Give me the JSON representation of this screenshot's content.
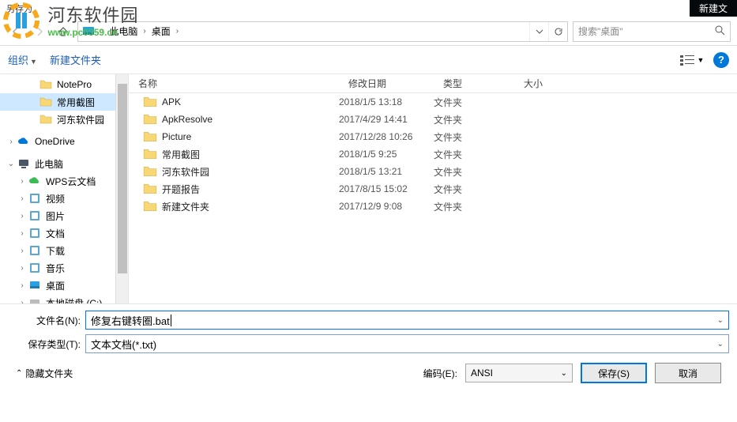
{
  "topbar": {
    "saveas": "另存为",
    "newtab": "新建文"
  },
  "watermark": {
    "title": "河东软件园",
    "url": "www.pc0359.cn"
  },
  "breadcrumb": {
    "root": "此电脑",
    "current": "桌面"
  },
  "search": {
    "placeholder": "搜索\"桌面\""
  },
  "toolbar": {
    "organize": "组织",
    "newfolder": "新建文件夹"
  },
  "sidebar": {
    "items": [
      {
        "label": "NotePro",
        "type": "folder"
      },
      {
        "label": "常用截图",
        "type": "folder",
        "selected": true
      },
      {
        "label": "河东软件园",
        "type": "folder"
      },
      {
        "label": "OneDrive",
        "type": "cloud",
        "exp": ">"
      },
      {
        "label": "此电脑",
        "type": "pc",
        "exp": "⌄"
      },
      {
        "label": "WPS云文档",
        "type": "cloud2",
        "exp": ">"
      },
      {
        "label": "视频",
        "type": "lib",
        "exp": ">"
      },
      {
        "label": "图片",
        "type": "lib",
        "exp": ">"
      },
      {
        "label": "文档",
        "type": "lib",
        "exp": ">"
      },
      {
        "label": "下载",
        "type": "lib",
        "exp": ">"
      },
      {
        "label": "音乐",
        "type": "lib",
        "exp": ">"
      },
      {
        "label": "桌面",
        "type": "desktop",
        "exp": ">",
        "active": true
      },
      {
        "label": "本地磁盘 (C:)",
        "type": "disk",
        "exp": ">"
      }
    ]
  },
  "columns": {
    "name": "名称",
    "date": "修改日期",
    "type": "类型",
    "size": "大小"
  },
  "files": [
    {
      "name": "APK",
      "date": "2018/1/5 13:18",
      "type": "文件夹"
    },
    {
      "name": "ApkResolve",
      "date": "2017/4/29 14:41",
      "type": "文件夹"
    },
    {
      "name": "Picture",
      "date": "2017/12/28 10:26",
      "type": "文件夹"
    },
    {
      "name": "常用截图",
      "date": "2018/1/5 9:25",
      "type": "文件夹"
    },
    {
      "name": "河东软件园",
      "date": "2018/1/5 13:21",
      "type": "文件夹"
    },
    {
      "name": "开题报告",
      "date": "2017/8/15 15:02",
      "type": "文件夹"
    },
    {
      "name": "新建文件夹",
      "date": "2017/12/9 9:08",
      "type": "文件夹"
    }
  ],
  "form": {
    "filename_label": "文件名(N):",
    "filename_value": "修复右键转圈.bat",
    "savetype_label": "保存类型(T):",
    "savetype_value": "文本文档(*.txt)"
  },
  "footer": {
    "hide": "隐藏文件夹",
    "encoding_label": "编码(E):",
    "encoding_value": "ANSI",
    "save": "保存(S)",
    "cancel": "取消"
  }
}
